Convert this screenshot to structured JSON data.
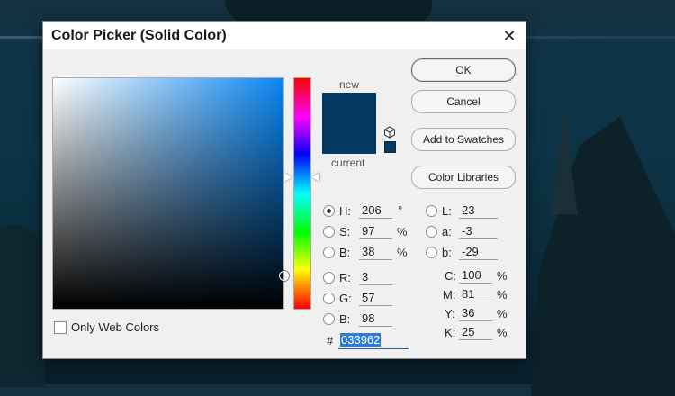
{
  "dialog": {
    "title": "Color Picker (Solid Color)",
    "close_symbol": "✕"
  },
  "preview": {
    "new_label": "new",
    "current_label": "current",
    "new_color": "#033962",
    "current_color": "#033962",
    "gamut_icon": "cube-icon"
  },
  "buttons": {
    "ok": "OK",
    "cancel": "Cancel",
    "add_to_swatches": "Add to Swatches",
    "color_libraries": "Color Libraries"
  },
  "hsb": {
    "h_label": "H:",
    "h_value": "206",
    "h_unit": "°",
    "s_label": "S:",
    "s_value": "97",
    "s_unit": "%",
    "b_label": "B:",
    "b_value": "38",
    "b_unit": "%",
    "selected": "H"
  },
  "rgb": {
    "r_label": "R:",
    "r_value": "3",
    "g_label": "G:",
    "g_value": "57",
    "b_label": "B:",
    "b_value": "98"
  },
  "lab": {
    "l_label": "L:",
    "l_value": "23",
    "a_label": "a:",
    "a_value": "-3",
    "b_label": "b:",
    "b_value": "-29"
  },
  "cmyk": {
    "c_label": "C:",
    "c_value": "100",
    "c_unit": "%",
    "m_label": "M:",
    "m_value": "81",
    "m_unit": "%",
    "y_label": "Y:",
    "y_value": "36",
    "y_unit": "%",
    "k_label": "K:",
    "k_value": "25",
    "k_unit": "%"
  },
  "hex": {
    "hash": "#",
    "value": "033962"
  },
  "web_colors": {
    "label": "Only Web Colors",
    "checked": false
  },
  "colors": {
    "selected_color": "#033962",
    "field_hue_color": "#0a86f2",
    "hex_highlight": "#2f7bd8"
  }
}
